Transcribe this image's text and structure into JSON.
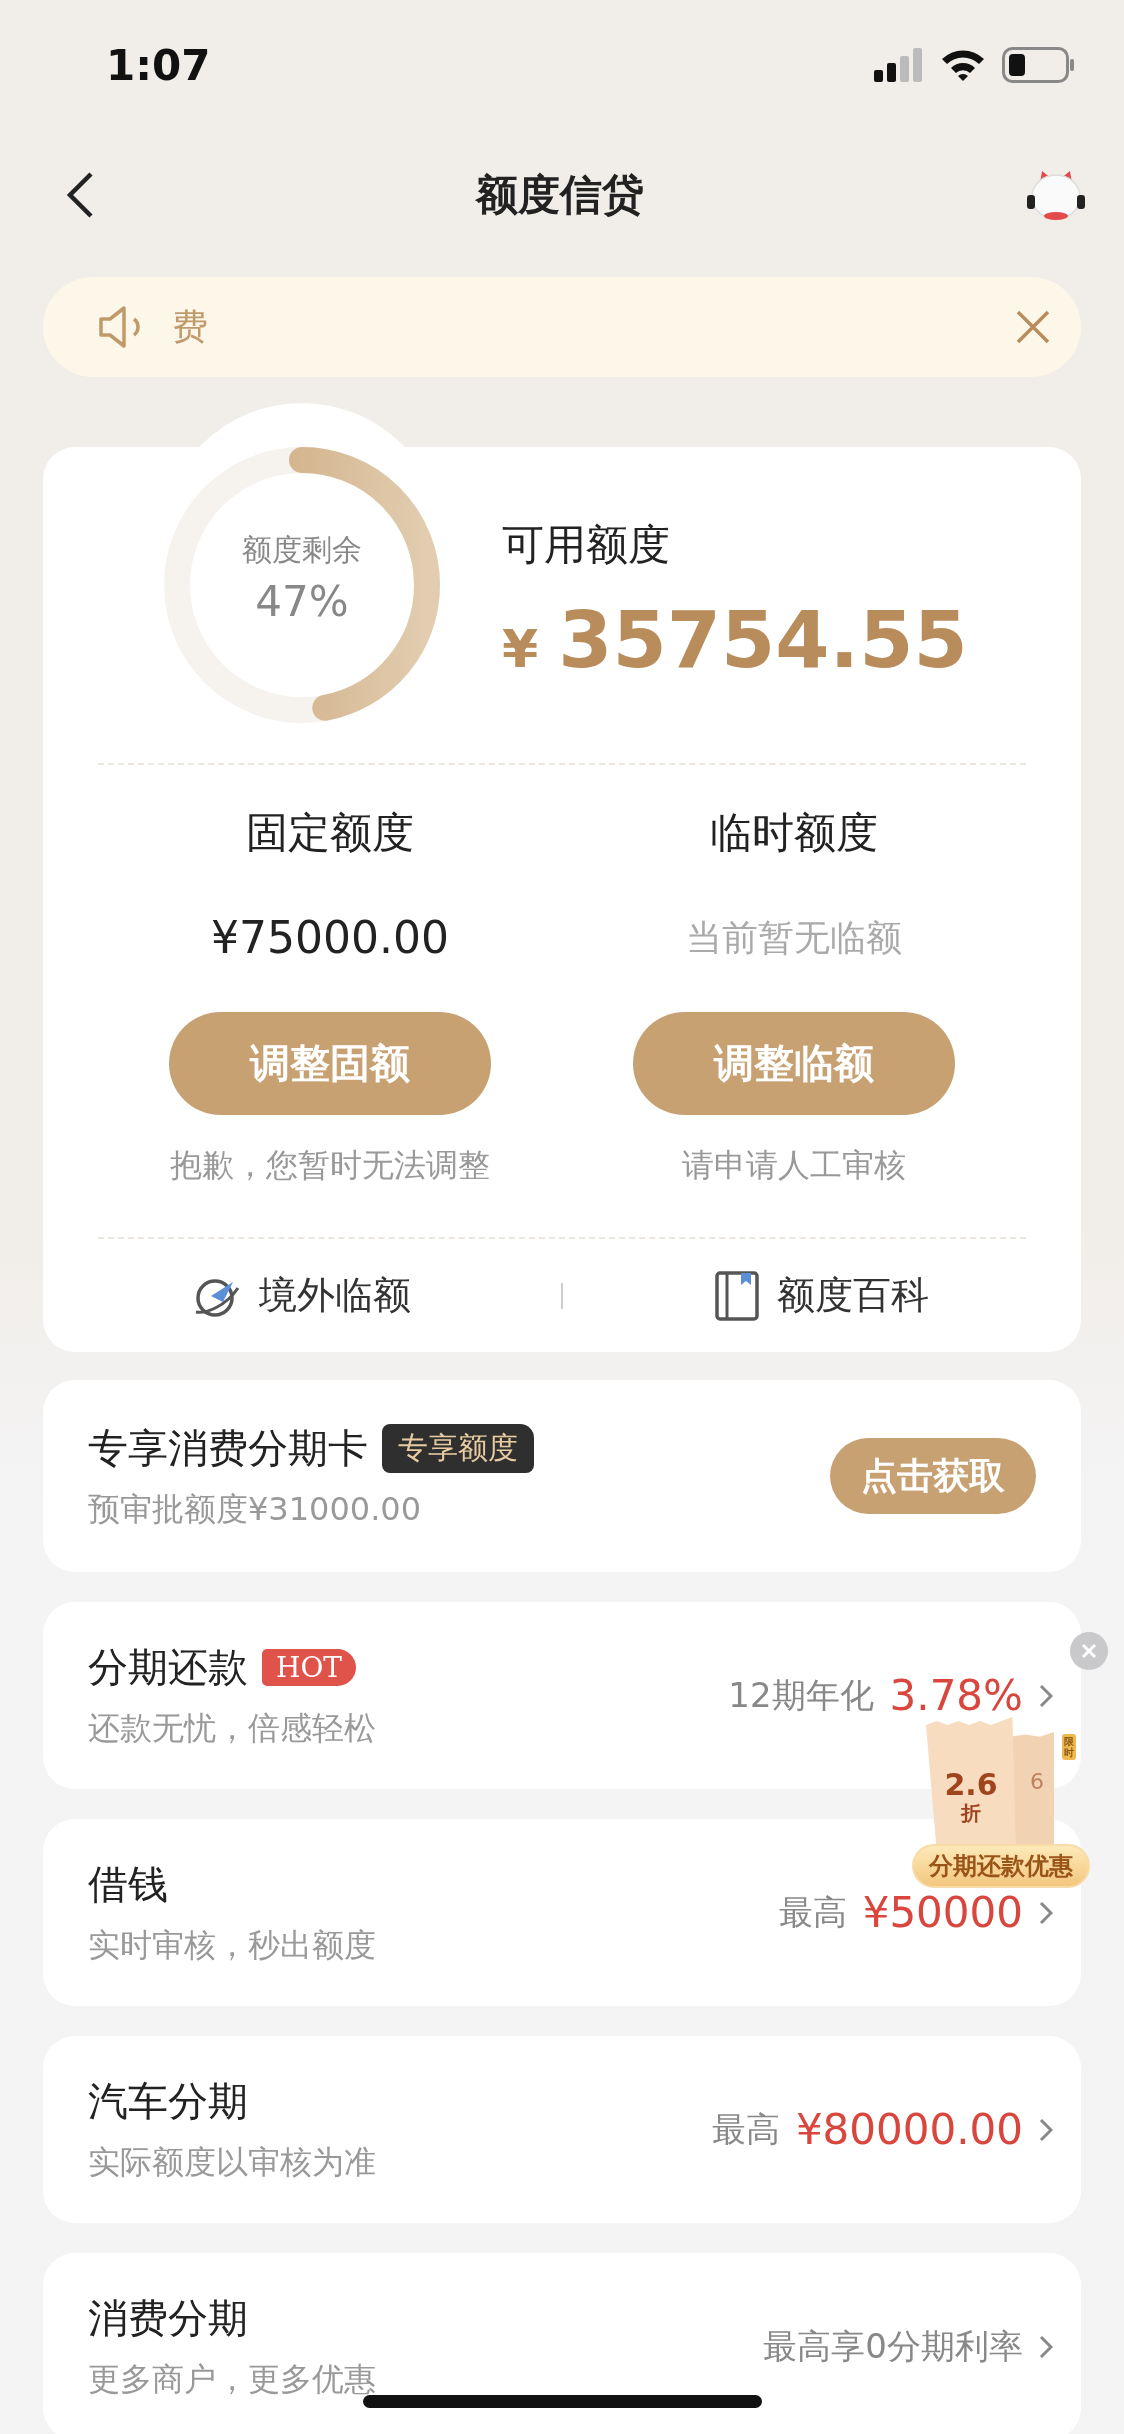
{
  "status_bar": {
    "time": "1:07"
  },
  "nav": {
    "title": "额度信贷"
  },
  "notice": {
    "text": "费"
  },
  "credit": {
    "ring_label": "额度剩余",
    "ring_percent": "47%",
    "available_label": "可用额度",
    "currency": "¥",
    "available_amount": "35754.55",
    "columns": [
      {
        "title": "固定额度",
        "value": "¥75000.00",
        "muted": false,
        "button": "调整固额",
        "note": "抱歉，您暂时无法调整"
      },
      {
        "title": "临时额度",
        "value": "当前暂无临额",
        "muted": true,
        "button": "调整临额",
        "note": "请申请人工审核"
      }
    ],
    "links": [
      {
        "kind": "plane",
        "label": "境外临额"
      },
      {
        "kind": "book",
        "label": "额度百科"
      }
    ]
  },
  "exclusive": {
    "title": "专享消费分期卡",
    "tag": "专享额度",
    "subtitle": "预审批额度¥31000.00",
    "button": "点击获取"
  },
  "products": [
    {
      "title": "分期还款",
      "tag": "HOT",
      "subtitle": "还款无忧，倍感轻松",
      "prefix": "12期年化",
      "value": "3.78%"
    },
    {
      "title": "借钱",
      "subtitle": "实时审核，秒出额度",
      "prefix": "最高",
      "value": "¥50000"
    },
    {
      "title": "汽车分期",
      "subtitle": "实际额度以审核为准",
      "prefix": "最高",
      "value": "¥80000.00"
    },
    {
      "title": "消费分期",
      "subtitle": "更多商户，更多优惠",
      "prefix": "最高享0分期利率"
    }
  ],
  "promo": {
    "discount": "2.6",
    "unit": "折",
    "back_digit": "6",
    "stamp": "限时",
    "label": "分期还款优惠"
  }
}
